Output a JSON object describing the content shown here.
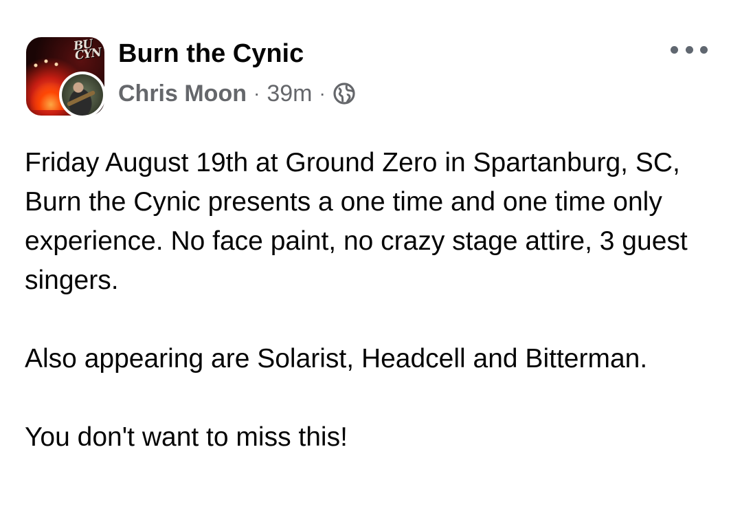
{
  "post": {
    "page_name": "Burn the Cynic",
    "page_avatar_logo": "BURN THE CYNIC",
    "author": "Chris Moon",
    "separator": "·",
    "timestamp": "39m",
    "privacy_icon": "globe-icon",
    "more_icon": "more-horizontal-icon",
    "paragraphs": [
      "Friday August 19th at Ground Zero in Spartanburg, SC, Burn the Cynic presents a one time and one time only experience. No face paint, no crazy stage attire, 3 guest singers.",
      "Also appearing are Solarist, Headcell and Bitterman.",
      "You don't want to miss this!"
    ]
  },
  "colors": {
    "text_primary": "#050505",
    "text_secondary": "#65676b",
    "background": "#ffffff"
  }
}
